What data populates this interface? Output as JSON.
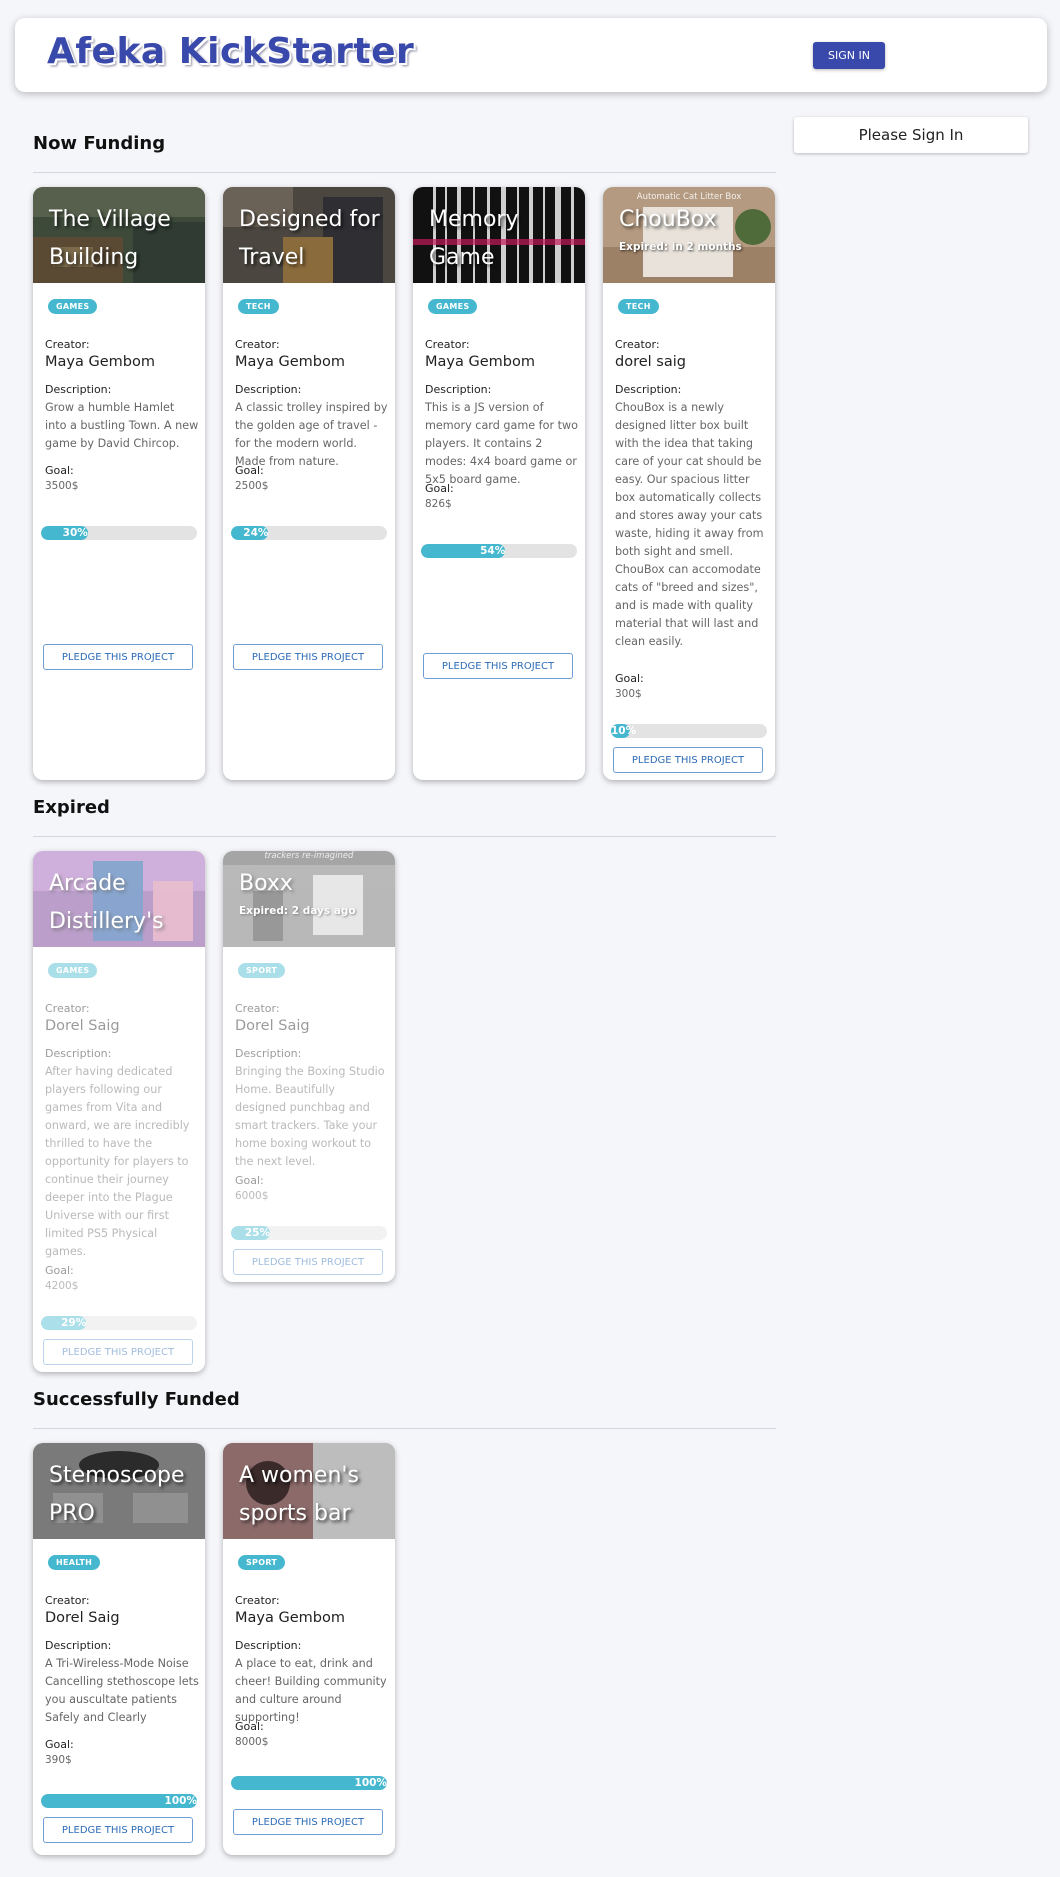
{
  "header": {
    "title": "Afeka KickStarter",
    "signin_label": "Sign In"
  },
  "sidebar": {
    "signin_prompt": "Please Sign In"
  },
  "colors": {
    "accent": "#3949ab",
    "chip": "#45b8cf",
    "progress": "#45b8cf"
  },
  "sections": {
    "funding": {
      "title": "Now Funding"
    },
    "expired": {
      "title": "Expired"
    },
    "funded": {
      "title": "Successfully Funded"
    }
  },
  "labels": {
    "creator": "Creator:",
    "description": "Description:",
    "goal": "Goal:",
    "pledge": "Pledge this project"
  },
  "cards": {
    "village": {
      "title": "The Village Building Game",
      "category": "Games",
      "creator": "Maya Gembom",
      "description": "Grow a humble Hamlet into a bustling Town. A new game by David Chircop.",
      "goal": "3500$",
      "progress_label": "30%",
      "progress": 30
    },
    "travel": {
      "title": "Designed for Travel",
      "category": "Tech",
      "creator": "Maya Gembom",
      "description": "A classic trolley inspired by the golden age of travel - for the modern world. Made from nature.",
      "goal": "2500$",
      "progress_label": "24%",
      "progress": 24
    },
    "memory": {
      "title": "Memory Game",
      "category": "Games",
      "creator": "Maya Gembom",
      "description": "This is a JS version of memory card game for two players. It contains 2 modes: 4x4 board game or 5x5 board game.",
      "goal": "826$",
      "progress_label": "54%",
      "progress": 54
    },
    "choubox": {
      "title": "ChouBox",
      "expiry": "Expired: in 2 months",
      "category": "Tech",
      "creator": "dorel saig",
      "description": "ChouBox is a newly designed litter box built with the idea that taking care of your cat should be easy. Our spacious litter box automatically collects and stores away your cats waste, hiding it away from both sight and smell. ChouBox can accomodate cats of \"breed and sizes\", and is made with quality material that will last and clean easily.",
      "goal": "300$",
      "progress_label": "10%",
      "progress": 10,
      "image_caption": "Automatic Cat Litter Box"
    },
    "arcade": {
      "title": "Arcade Distillery's",
      "category": "Games",
      "creator": "Dorel Saig",
      "description": "After having dedicated players following our games from Vita and onward, we are incredibly thrilled to have the opportunity for players to continue their journey deeper into the Plague Universe with our first limited PS5 Physical games.",
      "goal": "4200$",
      "progress_label": "29%",
      "progress": 29
    },
    "boxx": {
      "title": "Boxx",
      "expiry": "Expired: 2 days ago",
      "category": "Sport",
      "creator": "Dorel Saig",
      "description": "Bringing the Boxing Studio Home. Beautifully designed punchbag and smart trackers. Take your home boxing workout to the next level.",
      "goal": "6000$",
      "progress_label": "25%",
      "progress": 25,
      "image_caption": "trackers re-imagined"
    },
    "stemoscope": {
      "title": "Stemoscope PRO",
      "category": "Health",
      "creator": "Dorel Saig",
      "description": "A Tri-Wireless-Mode Noise Cancelling stethoscope lets you auscultate patients Safely and Clearly",
      "goal": "390$",
      "progress_label": "100%",
      "progress": 100
    },
    "sportsbar": {
      "title": "A women's sports bar",
      "category": "Sport",
      "creator": "Maya Gembom",
      "description": "A place to eat, drink and cheer! Building community and culture around supporting!",
      "goal": "8000$",
      "progress_label": "100%",
      "progress": 100
    }
  }
}
